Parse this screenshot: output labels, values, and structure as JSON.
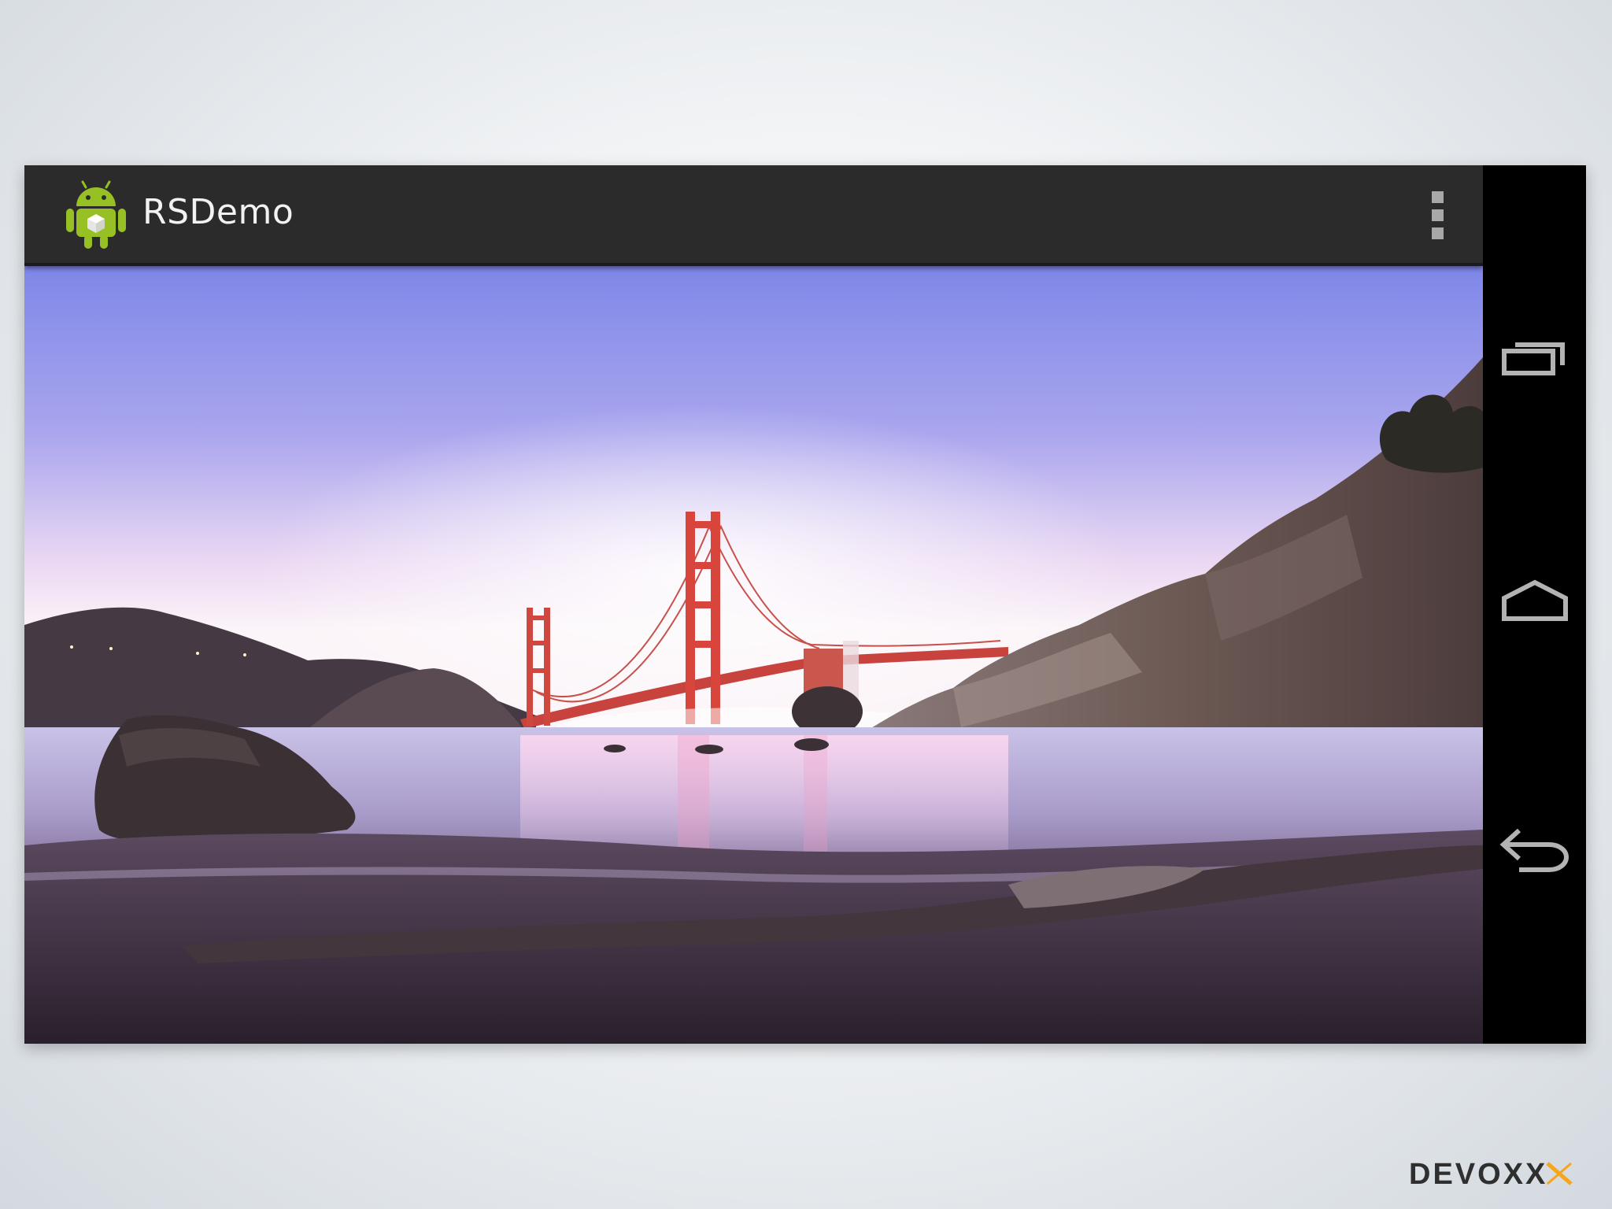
{
  "app": {
    "title": "RSDemo",
    "icon": "android-robot-icon",
    "overflow_icon": "overflow-menu-icon"
  },
  "photo": {
    "subject": "golden-gate-bridge-beach-photo"
  },
  "nav_bar": {
    "recent_icon": "recent-apps-icon",
    "home_icon": "home-icon",
    "back_icon": "back-icon"
  },
  "branding": {
    "logo_text": "DEVOXX"
  },
  "colors": {
    "action_bar": "#2b2b2b",
    "android_green": "#97c024",
    "bridge_red": "#d7453c",
    "sky_top": "#7d86e8",
    "sky_horizon": "#f7eef8"
  }
}
